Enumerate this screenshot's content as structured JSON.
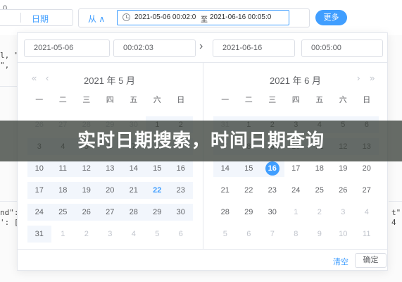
{
  "topbar": {
    "period_label": "日期",
    "toggle_label": "从 ∧",
    "range_start": "2021-05-06 00:02:0",
    "range_sep": "至",
    "range_end": "2021-06-16 00:05:0",
    "more_label": "更多",
    "left_num": "0"
  },
  "background_code": {
    "line1": "l, \"da",
    "line2": "\",",
    "line3": "nd\":",
    "line4": "': [ 4",
    "right1": "t\"",
    "right2": "4"
  },
  "picker": {
    "start_date": "2021-05-06",
    "start_time": "00:02:03",
    "end_date": "2021-06-16",
    "end_time": "00:05:00",
    "left_title": "2021 年 5 月",
    "right_title": "2021 年 6 月",
    "weekdays": [
      "一",
      "二",
      "三",
      "四",
      "五",
      "六",
      "日"
    ],
    "nav": {
      "prev_year": "«",
      "prev_month": "‹",
      "next_month": "›",
      "next_year": "»",
      "between": "›"
    },
    "left_rows": [
      [
        "26",
        "27",
        "28",
        "29",
        "30",
        "1",
        "2"
      ],
      [
        "3",
        "4",
        "5",
        "6",
        "7",
        "8",
        "9"
      ],
      [
        "10",
        "11",
        "12",
        "13",
        "14",
        "15",
        "16"
      ],
      [
        "17",
        "18",
        "19",
        "20",
        "21",
        "22",
        "23"
      ],
      [
        "24",
        "25",
        "26",
        "27",
        "28",
        "29",
        "30"
      ],
      [
        "31",
        "1",
        "2",
        "3",
        "4",
        "5",
        "6"
      ]
    ],
    "right_rows": [
      [
        "31",
        "1",
        "2",
        "3",
        "4",
        "5",
        "6"
      ],
      [
        "7",
        "8",
        "9",
        "10",
        "11",
        "12",
        "13"
      ],
      [
        "14",
        "15",
        "16",
        "17",
        "18",
        "19",
        "20"
      ],
      [
        "21",
        "22",
        "23",
        "24",
        "25",
        "26",
        "27"
      ],
      [
        "28",
        "29",
        "30",
        "1",
        "2",
        "3",
        "4"
      ],
      [
        "5",
        "6",
        "7",
        "8",
        "9",
        "10",
        "11"
      ]
    ],
    "clear_label": "清空",
    "ok_label": "确定"
  },
  "banner": {
    "text": "实时日期搜索，时间日期查询"
  },
  "colors": {
    "accent": "#409eff",
    "muted": "#c0c4cc",
    "range_bg": "#f2f6fc"
  }
}
